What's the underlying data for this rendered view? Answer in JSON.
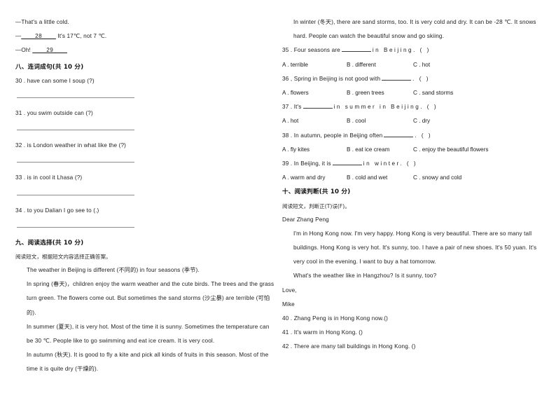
{
  "document": {
    "type": "english-exam-paper",
    "layout": "two-column"
  },
  "left_column": {
    "dialogue_tail": {
      "lines": [
        "—That's a little cold.",
        "—____28____ It's 17℃, not 7 ℃.",
        "—Oh! ____29____"
      ],
      "line1": "—That's a little cold.",
      "line2_prefix": "—",
      "line2_blank": "____28____",
      "line2_rest": "It's 17℃, not 7 ℃.",
      "line3_prefix": "—Oh!",
      "line3_blank": "____29____"
    },
    "section_eight": {
      "heading": "八、连词成句(共 10 分)",
      "items": [
        {
          "number": "30",
          "sep": ".",
          "text": "have  can  some  I  soup (?)"
        },
        {
          "number": "31",
          "sep": ".",
          "text": "you  swim  outside   can  (?)"
        },
        {
          "number": "32",
          "sep": ".",
          "text": "is  London  weather  in  what  like  the (?)"
        },
        {
          "number": "33",
          "sep": ".",
          "text": "is  in  cool  it  Lhasa (?)"
        },
        {
          "number": "34",
          "sep": ".",
          "text": "to you Dalian  I  go  see  to (.)"
        }
      ]
    },
    "section_nine": {
      "heading": "九、阅读选择(共 10 分)",
      "instruction": "阅读短文，根据短文内容选择正确答案。",
      "passage": [
        "The weather in Beijing is different (不同的) in four seasons (季节).",
        "In spring (春天)，children enjoy the warm weather and the cute birds. The trees and the grass turn green. The flowers come out. But sometimes the sand storms (沙尘暴) are terrible (可怕的).",
        "In summer (夏天), it is very hot. Most of the time it is sunny. Sometimes the temperature can be 30 ℃. People like to go swimming and eat ice cream. It is very cool.",
        "In autumn (秋天). It is good to fly a kite and pick all kinds of fruits in this season. Most of the time it is quite dry (干燥的)."
      ]
    }
  },
  "right_column": {
    "section_nine_continued": {
      "passage": [
        "In winter (冬天), there are sand storms, too. It is very cold and dry. It can be -28 ℃. It snows hard. People can watch the beautiful snow and go skiing."
      ],
      "questions": [
        {
          "number": "35",
          "sep": ".",
          "stem_before": "Four seasons are",
          "stem_after": "in Beijing. (  )",
          "options": [
            {
              "letter": "A",
              "text": "terrible"
            },
            {
              "letter": "B",
              "text": "different"
            },
            {
              "letter": "C",
              "text": "hot"
            }
          ]
        },
        {
          "number": "36",
          "sep": ",",
          "stem_before": "Spring in Beijing is not good with",
          "stem_after": ". (  )",
          "options": [
            {
              "letter": "A",
              "text": "flowers"
            },
            {
              "letter": "B",
              "text": "green trees"
            },
            {
              "letter": "C",
              "text": "sand storms"
            }
          ]
        },
        {
          "number": "37",
          "sep": ".",
          "stem_before": "It's",
          "stem_after": "in summer in Beijing. (  )",
          "options": [
            {
              "letter": "A",
              "text": "hot"
            },
            {
              "letter": "B",
              "text": "cool"
            },
            {
              "letter": "C",
              "text": "dry"
            }
          ]
        },
        {
          "number": "38",
          "sep": ".",
          "stem_before": "In autumn, people in Beijing often",
          "stem_after": ". (  )",
          "options": [
            {
              "letter": "A",
              "text": "fly kites"
            },
            {
              "letter": "B",
              "text": "eat ice cream"
            },
            {
              "letter": "C",
              "text": "enjoy the beautiful flowers"
            }
          ]
        },
        {
          "number": "39",
          "sep": ".",
          "stem_before": "In Beijing, it is",
          "stem_after": "in winter. (  )",
          "options": [
            {
              "letter": "A",
              "text": "warm and dry"
            },
            {
              "letter": "B",
              "text": "cold and wet"
            },
            {
              "letter": "C",
              "text": "snowy and cold"
            }
          ]
        }
      ]
    },
    "section_ten": {
      "heading": "十、阅读判断(共 10 分)",
      "instruction": "阅读短文，判断正(T)误(F)。",
      "letter": {
        "salutation": "Dear Zhang Peng",
        "body": [
          "I'm in Hong Kong now. I'm very happy. Hong Kong is very beautiful. There are so many tall buildings. Hong Kong is very hot. It's sunny, too. I have a pair of new shoes. It's 50 yuan. It's very cool in the evening. I want to buy a hat tomorrow.",
          "What's the weather like in Hangzhou? Is it sunny, too?"
        ],
        "closing": "Love,",
        "signature": "Mike"
      },
      "statements": [
        {
          "number": "40",
          "sep": ".",
          "text": "Zhang Peng is in Hong Kong now.(",
          "close": ")"
        },
        {
          "number": "41",
          "sep": ".",
          "text": "It's warm in Hong Kong. (",
          "close": ")"
        },
        {
          "number": "42",
          "sep": ".",
          "text": "There are many tall buildings in Hong Kong. (",
          "close": ")"
        }
      ]
    }
  }
}
